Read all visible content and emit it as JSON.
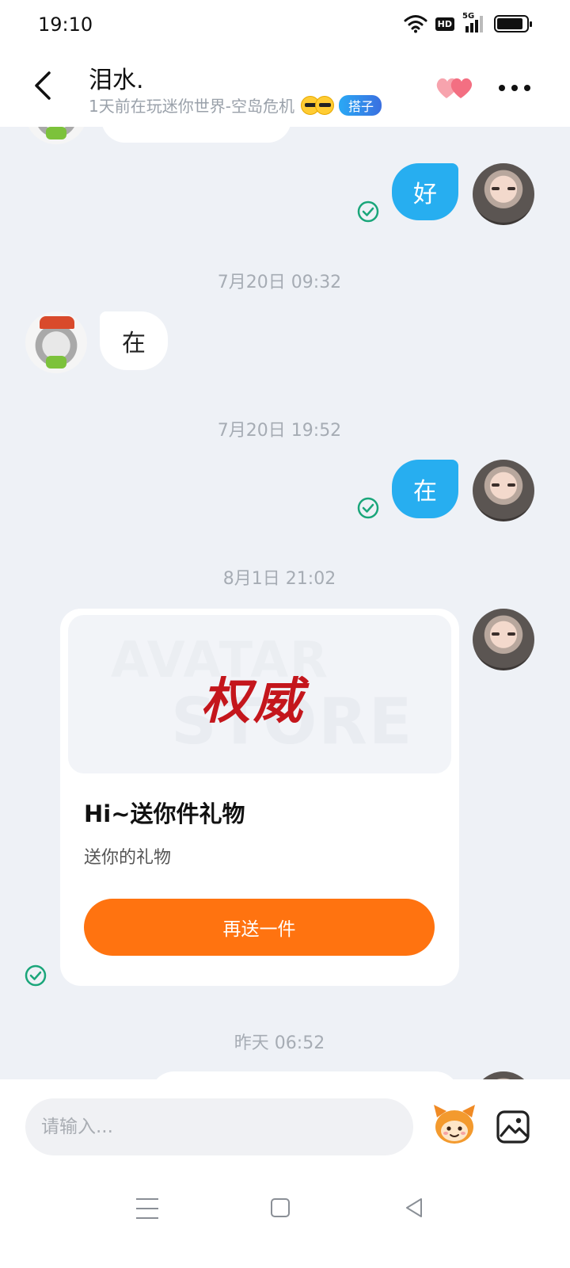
{
  "status_bar": {
    "time": "19:10",
    "hd_label": "HD",
    "network_label": "5G",
    "battery_level": 0.9,
    "icons": [
      "wifi-icon",
      "hd-icon",
      "signal-5g-icon",
      "battery-icon"
    ]
  },
  "header": {
    "contact_name": "泪水.",
    "contact_status": "1天前在玩迷你世界-空岛危机",
    "tag_label": "搭子",
    "icons": [
      "back-icon",
      "hearts-icon",
      "more-icon"
    ]
  },
  "chat": {
    "messages": [
      {
        "type": "outgoing",
        "text": "好",
        "status": "read"
      },
      {
        "type": "timestamp",
        "text": "7月20日 09:32"
      },
      {
        "type": "incoming",
        "text": "在"
      },
      {
        "type": "timestamp",
        "text": "7月20日 19:52"
      },
      {
        "type": "outgoing",
        "text": "在",
        "status": "read"
      },
      {
        "type": "timestamp",
        "text": "8月1日 21:02"
      },
      {
        "type": "gift_card",
        "banner_bg_line1": "AVATAR",
        "banner_bg_line2": "STORE",
        "banner_brand": "权威",
        "title": "Hi~送你件礼物",
        "description": "送你的礼物",
        "button_label": "再送一件",
        "status": "read"
      },
      {
        "type": "timestamp",
        "text": "昨天 06:52"
      }
    ]
  },
  "input_bar": {
    "placeholder": "请输入...",
    "value": "",
    "icons": [
      "mascot-emoji-icon",
      "image-icon"
    ]
  },
  "nav_bar": {
    "icons": [
      "menu-icon",
      "home-icon",
      "back-triangle-icon"
    ]
  },
  "colors": {
    "outgoing_bubble": "#27aef0",
    "incoming_bubble": "#ffffff",
    "chat_background": "#eef1f6",
    "gift_button": "#ff7310",
    "read_check": "#1aa67a",
    "tag_pill": "#2aa9f5"
  }
}
